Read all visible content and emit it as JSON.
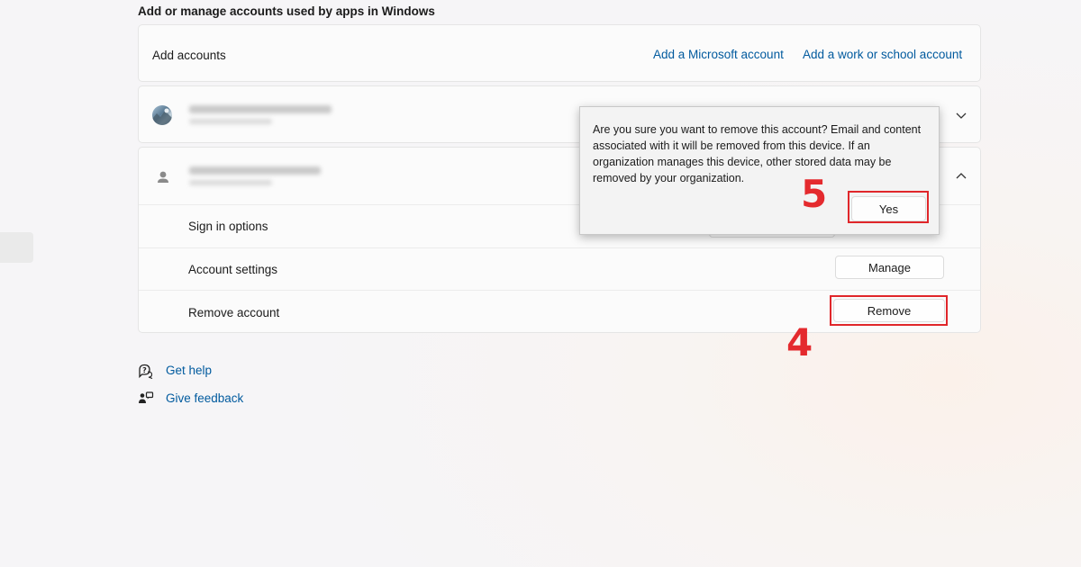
{
  "section": {
    "title": "Add or manage accounts used by apps in Windows"
  },
  "add_accounts": {
    "label": "Add accounts",
    "add_microsoft_link": "Add a Microsoft account",
    "add_work_link": "Add a work or school account"
  },
  "account_options": {
    "sign_in_label": "Sign in options",
    "account_settings_label": "Account settings",
    "manage_button": "Manage",
    "remove_label": "Remove account",
    "remove_button": "Remove"
  },
  "dialog": {
    "message": "Are you sure you want to remove this account? Email and content associated with it will be removed from this device. If an organization manages this device, other stored data may be removed by your organization.",
    "yes_button": "Yes"
  },
  "annotations": {
    "step_remove": "4",
    "step_yes": "5",
    "highlight_color": "#e0262a"
  },
  "footer": {
    "get_help": "Get help",
    "give_feedback": "Give feedback"
  },
  "icons": {
    "chevron_collapsed": "chevron-down-icon",
    "chevron_expanded": "chevron-up-icon",
    "help": "help-chat-icon",
    "feedback": "feedback-icon"
  }
}
